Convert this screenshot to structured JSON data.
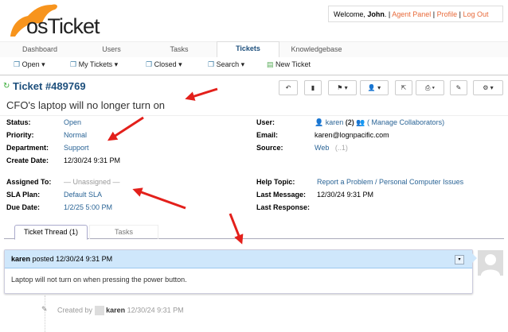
{
  "header": {
    "logo_text": "osTicket",
    "welcome": "Welcome, ",
    "user": "John",
    "links": [
      "Agent Panel",
      "Profile",
      "Log Out"
    ]
  },
  "nav": {
    "tabs": [
      "Dashboard",
      "Users",
      "Tasks",
      "Tickets",
      "Knowledgebase"
    ],
    "active": "Tickets"
  },
  "subnav": [
    "Open",
    "My Tickets",
    "Closed",
    "Search",
    "New Ticket"
  ],
  "ticket": {
    "number": "Ticket #489769",
    "subject": "CFO's laptop will no longer turn on",
    "left": [
      {
        "label": "Status:",
        "value": "Open"
      },
      {
        "label": "Priority:",
        "value": "Normal"
      },
      {
        "label": "Department:",
        "value": "Support"
      },
      {
        "label": "Create Date:",
        "value": "12/30/24 9:31 PM"
      }
    ],
    "left2": [
      {
        "label": "Assigned To:",
        "value": "— Unassigned —"
      },
      {
        "label": "SLA Plan:",
        "value": "Default SLA"
      },
      {
        "label": "Due Date:",
        "value": "1/2/25 5:00 PM"
      }
    ],
    "user": {
      "label": "User:",
      "name": "karen",
      "count": "(2)",
      "collab": "( Manage Collaborators)"
    },
    "email": {
      "label": "Email:",
      "value": "karen@lognpacific.com"
    },
    "source": {
      "label": "Source:",
      "value": "Web",
      "extra": "(..1)"
    },
    "right2": [
      {
        "label": "Help Topic:",
        "value": "Report a Problem / Personal Computer Issues"
      },
      {
        "label": "Last Message:",
        "value": "12/30/24 9:31 PM"
      },
      {
        "label": "Last Response:",
        "value": ""
      }
    ]
  },
  "thread": {
    "tabs": [
      "Ticket Thread (1)",
      "Tasks"
    ],
    "poster": "karen",
    "posted": "posted 12/30/24 9:31 PM",
    "body": "Laptop will not turn on when pressing the power button.",
    "created_by": "Created by",
    "creator": "karen",
    "created_at": "12/30/24 9:31 PM"
  },
  "colors": {
    "accent": "#f7941d",
    "link": "#2a6496",
    "thread_header": "#cfe7fb",
    "arrow": "#e3201b"
  }
}
